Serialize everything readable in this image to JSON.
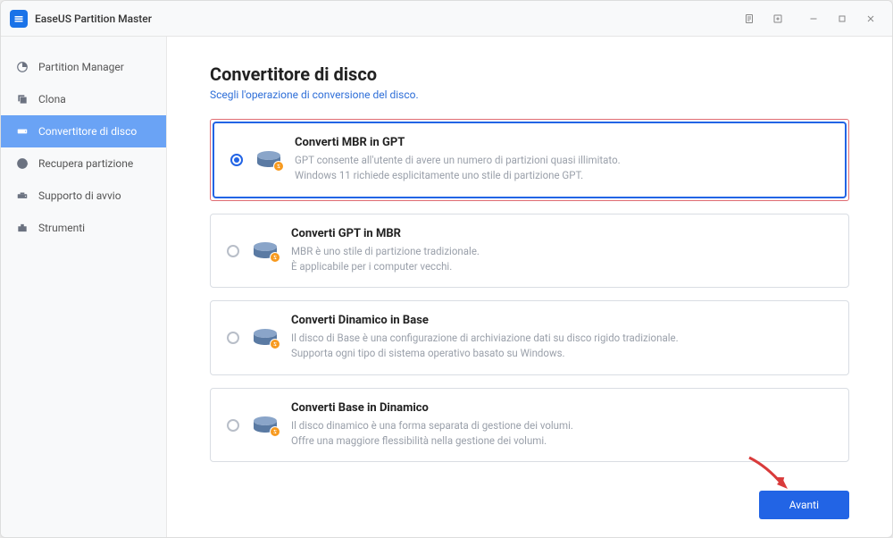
{
  "app": {
    "title": "EaseUS Partition Master"
  },
  "sidebar": {
    "items": [
      {
        "label": "Partition Manager"
      },
      {
        "label": "Clona"
      },
      {
        "label": "Convertitore di disco"
      },
      {
        "label": "Recupera partizione"
      },
      {
        "label": "Supporto di avvio"
      },
      {
        "label": "Strumenti"
      }
    ]
  },
  "page": {
    "title": "Convertitore di disco",
    "subtitle": "Scegli l'operazione di conversione del disco."
  },
  "options": [
    {
      "title": "Converti MBR in GPT",
      "line1": "GPT consente all'utente di avere un numero di partizioni quasi illimitato.",
      "line2": "Windows 11 richiede esplicitamente uno stile di partizione GPT."
    },
    {
      "title": "Converti GPT in MBR",
      "line1": "MBR è uno stile di partizione tradizionale.",
      "line2": "È applicabile per i computer vecchi."
    },
    {
      "title": "Converti Dinamico in Base",
      "line1": "Il disco di Base è una configurazione di archiviazione dati su disco rigido tradizionale.",
      "line2": "Supporta ogni tipo di sistema operativo basato su Windows."
    },
    {
      "title": "Converti Base in Dinamico",
      "line1": "Il disco dinamico è una forma separata di gestione dei volumi.",
      "line2": "Offre una maggiore flessibilità nella gestione dei volumi."
    }
  ],
  "footer": {
    "next": "Avanti"
  }
}
